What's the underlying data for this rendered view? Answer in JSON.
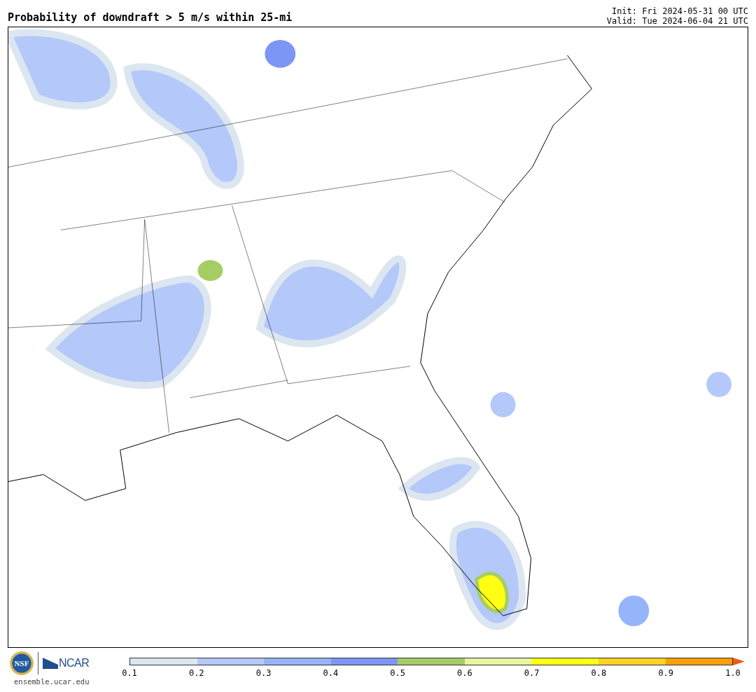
{
  "title": "Probability of downdraft > 5 m/s within 25-mi",
  "init": "Init: Fri 2024-05-31 00 UTC",
  "valid": "Valid: Tue 2024-06-04 21 UTC",
  "logos": {
    "nsf": "NSF",
    "ncar": "NCAR",
    "site": "ensemble.ucar.edu"
  },
  "colorbar": {
    "bins": [
      {
        "kind": "bin",
        "color": "#dce6f0"
      },
      {
        "kind": "bin",
        "color": "#b4c8fa"
      },
      {
        "kind": "bin",
        "color": "#96b4fa"
      },
      {
        "kind": "bin",
        "color": "#7d96f5"
      },
      {
        "kind": "bin",
        "color": "#a5cd64"
      },
      {
        "kind": "bin",
        "color": "#e6f5a0"
      },
      {
        "kind": "bin",
        "color": "#ffff14"
      },
      {
        "kind": "bin",
        "color": "#ffd223"
      },
      {
        "kind": "bin",
        "color": "#ffa00a"
      },
      {
        "kind": "arrow",
        "color": "#f05a14"
      }
    ],
    "ticks": [
      "0.1",
      "0.2",
      "0.3",
      "0.4",
      "0.5",
      "0.6",
      "0.7",
      "0.8",
      "0.9",
      "1.0"
    ]
  }
}
